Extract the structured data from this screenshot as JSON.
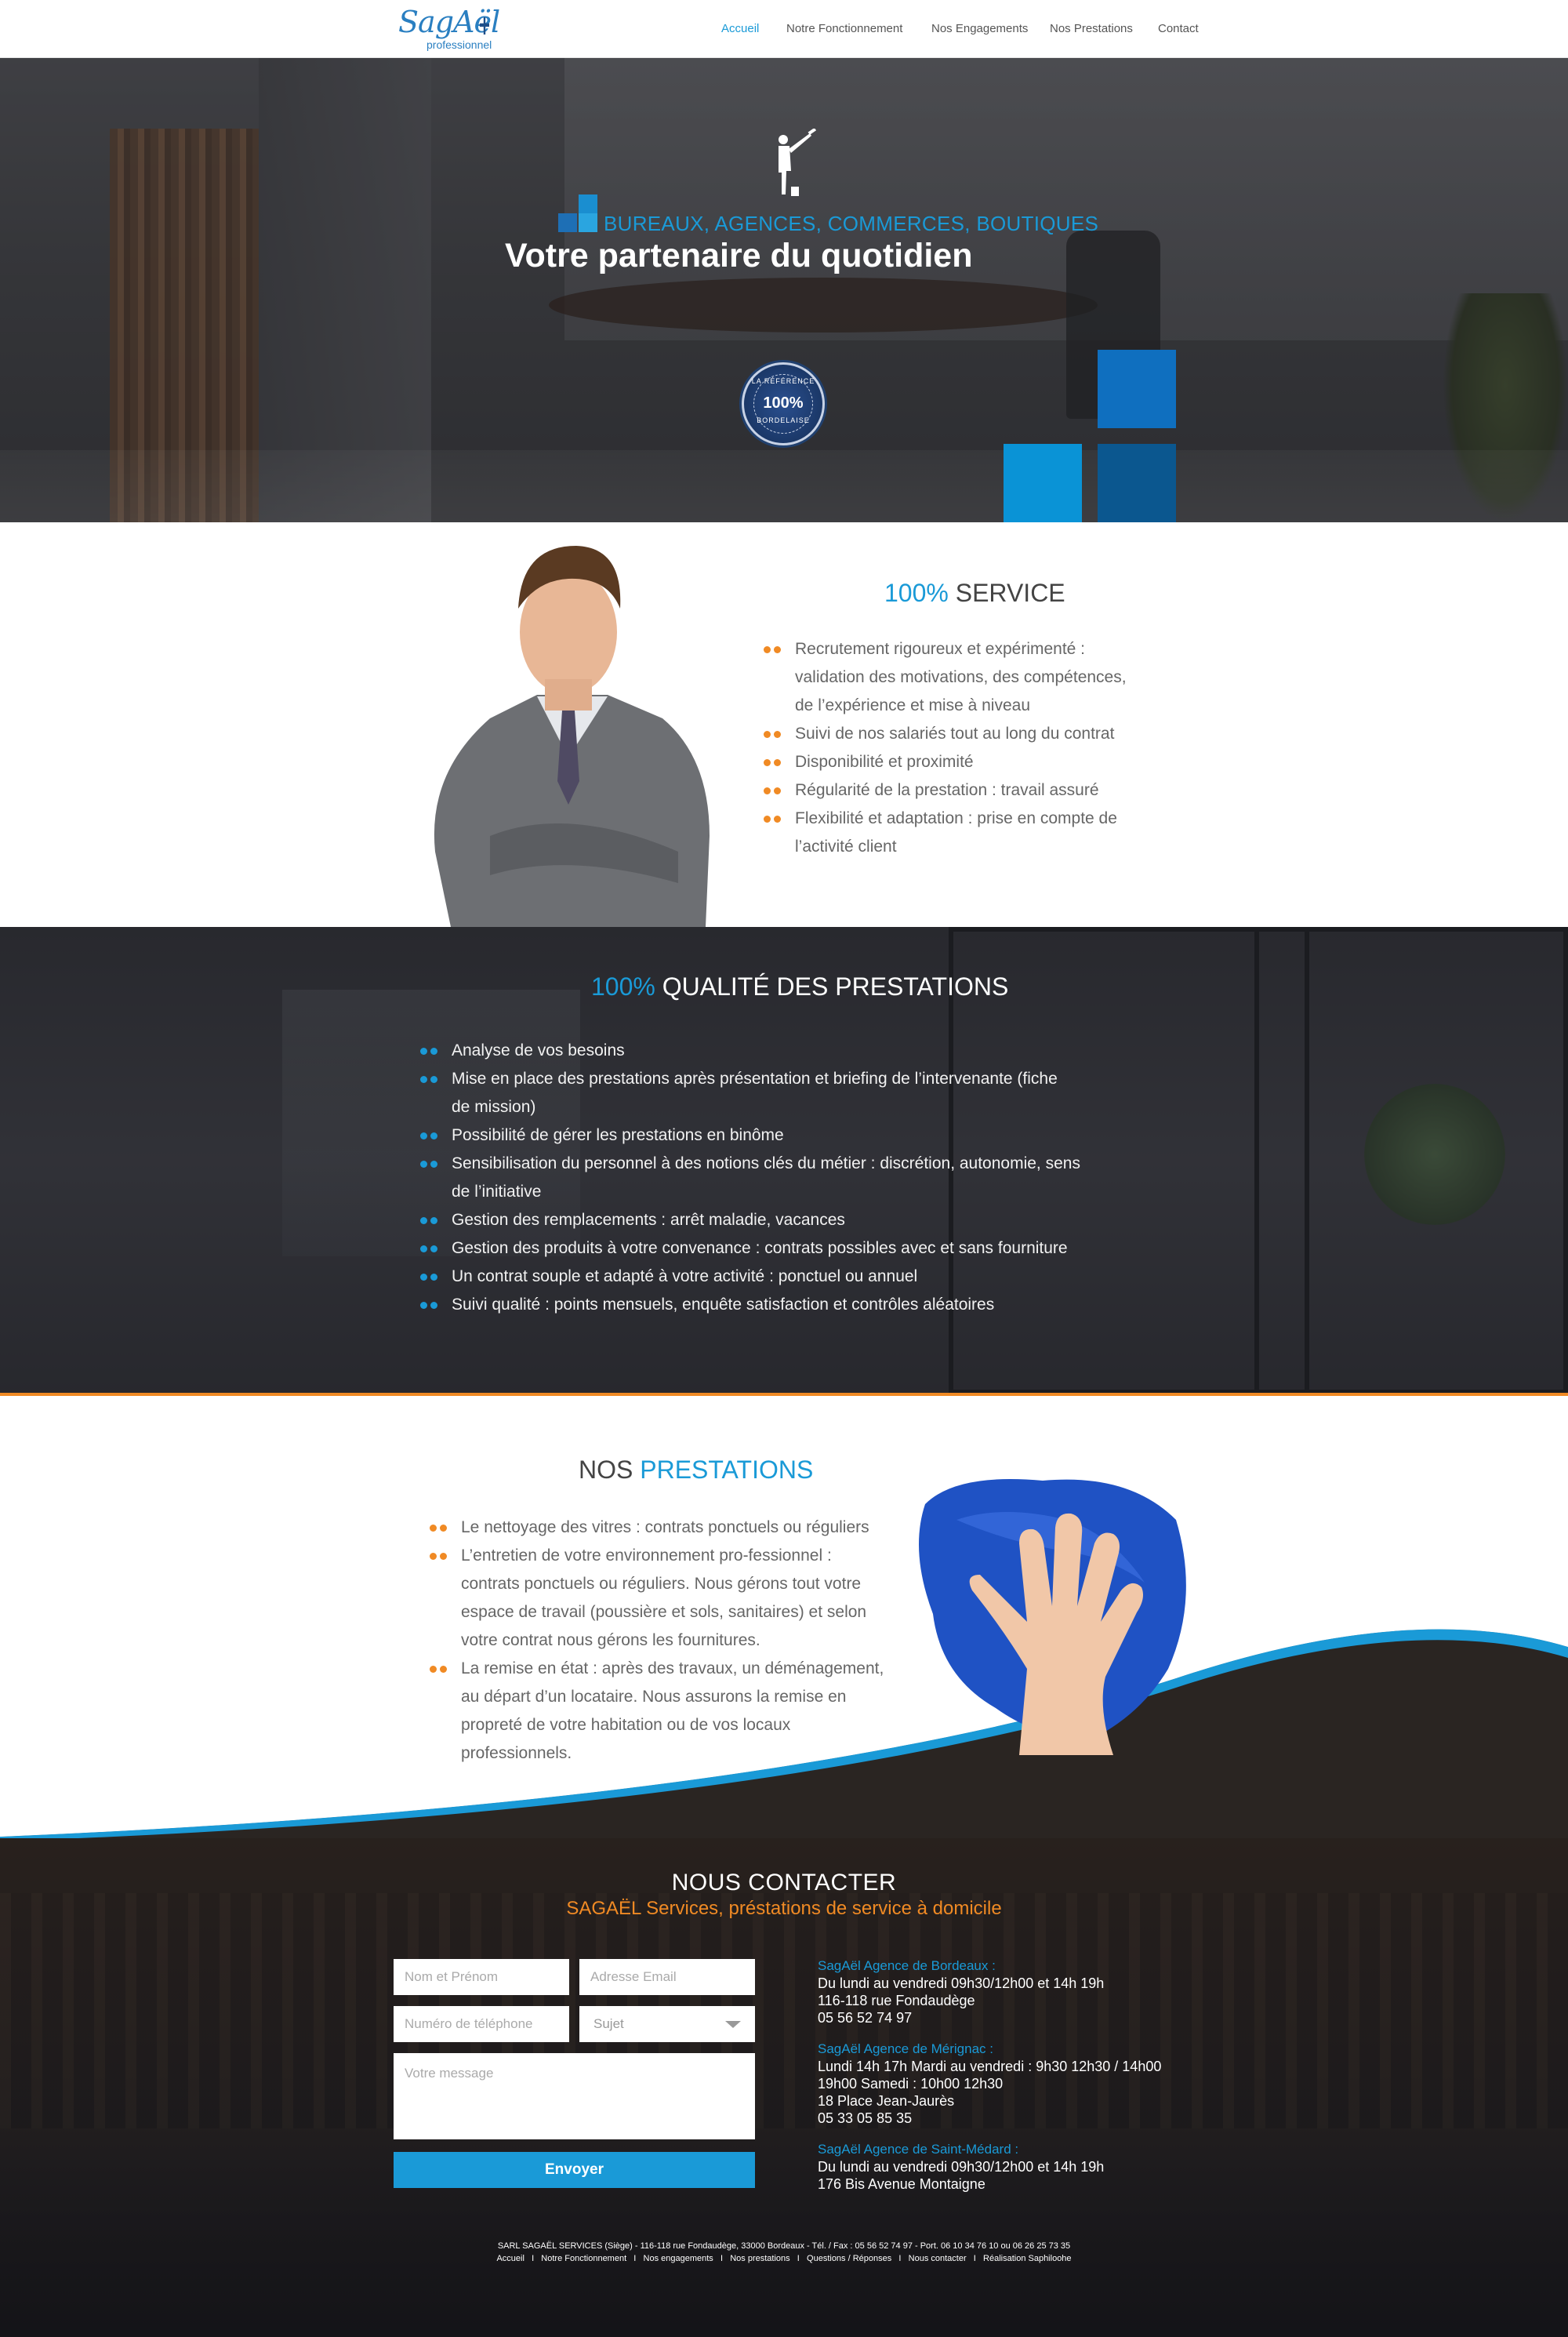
{
  "header": {
    "logo": {
      "brand": "SagAël",
      "sub": "professionnel"
    },
    "nav": [
      {
        "label": "Accueil",
        "active": true
      },
      {
        "label": "Notre Fonctionnement",
        "active": false
      },
      {
        "label": "Nos Engagements",
        "active": false
      },
      {
        "label": "Nos Prestations",
        "active": false
      },
      {
        "label": "Contact",
        "active": false
      }
    ]
  },
  "hero": {
    "subtitle": "BUREAUX, AGENCES, COMMERCES, BOUTIQUES",
    "title": "Votre partenaire du quotidien",
    "badge": {
      "top": "LA RÉFÉRENCE",
      "pct": "100%",
      "bottom": "BORDELAISE"
    }
  },
  "service": {
    "title_hl": "100%",
    "title_rest": " SERVICE",
    "items": [
      "Recrutement rigoureux et expérimenté :",
      "validation des motivations, des compétences,",
      "de l’expérience et mise à niveau",
      "Suivi de nos salariés tout au long du contrat",
      "Disponibilité et proximité",
      "Régularité de la prestation : travail assuré",
      "Flexibilité et adaptation : prise en compte de",
      "l’activité client"
    ]
  },
  "quality": {
    "title_hl": "100%",
    "title_rest": " QUALITÉ DES PRESTATIONS",
    "items": [
      "Analyse de vos besoins",
      "Mise en place des prestations après présentation et briefing de  l’intervenante (fiche",
      "de mission)",
      "Possibilité de gérer les prestations en binôme",
      "Sensibilisation du personnel à des notions clés du métier : discrétion, autonomie, sens",
      "de l’initiative",
      "Gestion des remplacements : arrêt maladie, vacances",
      "Gestion des produits à votre convenance :  contrats possibles avec et sans fourniture",
      "Un contrat souple et adapté à votre activité : ponctuel ou annuel",
      "Suivi qualité : points mensuels, enquête satisfaction et contrôles aléatoires"
    ]
  },
  "prestations": {
    "title_rest": "NOS ",
    "title_hl": "PRESTATIONS",
    "items": [
      "Le nettoyage des vitres : contrats ponctuels ou réguliers",
      "L’entretien de votre environnement pro-fessionnel :",
      "contrats ponctuels ou réguliers. Nous gérons tout votre",
      "espace de travail (poussière et sols, sanitaires) et selon",
      "votre contrat nous gérons les fournitures.",
      "La remise en état : après des travaux, un déménagement,",
      "au départ d’un locataire. Nous assurons la remise en",
      "propreté de votre habitation ou de vos locaux",
      "professionnels."
    ]
  },
  "contact": {
    "title": "NOUS CONTACTER",
    "subtitle": "SAGAËL Services, préstations de service à domicile",
    "form": {
      "name_placeholder": "Nom et Prénom",
      "email_placeholder": "Adresse Email",
      "phone_placeholder": "Numéro de téléphone",
      "subject_value": "Sujet",
      "message_placeholder": "Votre message",
      "send_label": "Envoyer"
    },
    "agencies": [
      {
        "name": "SagAël Agence de Bordeaux :",
        "lines": [
          "Du lundi au vendredi 09h30/12h00 et 14h 19h",
          "116-118 rue Fondaudège",
          "05 56 52 74 97"
        ]
      },
      {
        "name": "SagAël Agence de Mérignac :",
        "lines": [
          "Lundi 14h 17h Mardi au vendredi : 9h30 12h30 / 14h00",
          "19h00 Samedi : 10h00 12h30",
          "18 Place Jean-Jaurès",
          "05 33 05 85 35"
        ]
      },
      {
        "name": "SagAël Agence de Saint-Médard :",
        "lines": [
          "Du lundi au vendredi 09h30/12h00 et 14h 19h",
          "176 Bis Avenue Montaigne"
        ]
      }
    ]
  },
  "footer": {
    "line1": "SARL SAGAËL SERVICES (Siège) - 116-118 rue Fondaudège, 33000 Bordeaux - Tél. / Fax : 05 56 52 74 97 - Port. 06 10 34 76 10 ou 06 26 25 73 35",
    "line2": "Accueil   I   Notre Fonctionnement   I   Nos engagements   I   Nos prestations   I   Questions / Réponses   I   Nous contacter   I   Réalisation Saphiloohe"
  },
  "colors": {
    "accent_blue": "#1a9ad7",
    "accent_orange": "#f08a24",
    "dark_blue": "#1d4e89"
  }
}
